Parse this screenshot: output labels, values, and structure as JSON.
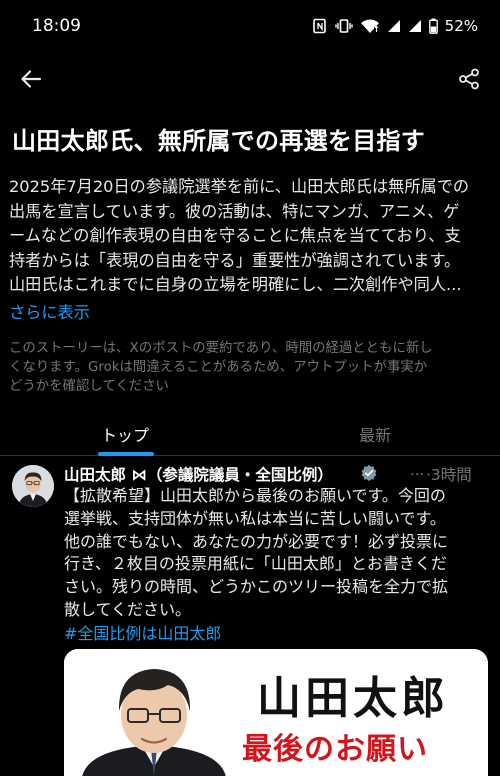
{
  "status_bar": {
    "time": "18:09",
    "battery": "52%"
  },
  "app_bar": {
    "back_icon": "arrow-left-icon",
    "share_icon": "share-icon"
  },
  "story": {
    "title": "山田太郎氏、無所属での再選を目指す",
    "summary_lines": [
      "2025年7月20日の参議院選挙を前に、山田太郎氏は無所属での",
      "出馬を宣言しています。彼の活動は、特にマンガ、アニメ、ゲ",
      "ームなどの創作表現の自由を守ることに焦点を当てており、支",
      "持者からは「表現の自由を守る」重要性が強調されています。",
      "山田氏はこれまでに自身の立場を明確にし、二次創作や同人..."
    ],
    "show_more": "さらに表示",
    "disclaimer_lines": [
      "このストーリーは、Xのポストの要約であり、時間の経過とともに新し",
      "くなります。Grokは間違えることがあるため、アウトプットが事実か",
      "どうかを確認してください"
    ]
  },
  "tabs": [
    {
      "label": "トップ",
      "active": true
    },
    {
      "label": "最新",
      "active": false
    }
  ],
  "post": {
    "author": "山田太郎 ⋈（参議院議員・全国比例）",
    "verified": true,
    "dots": "...",
    "time": "·3時間",
    "text_lines": [
      "【拡散希望】山田太郎から最後のお願いです。今回の",
      "選挙戦、支持団体が無い私は本当に苦しい闘いです。",
      "他の誰でもない、あなたの力が必要です！必ず投票に",
      "行き、２枚目の投票用紙に「山田太郎」とお書きくだ",
      "さい。残りの時間、どうかこのツリー投稿を全力で拡",
      "散してください。"
    ],
    "hashtag": "#全国比例は山田太郎",
    "media": {
      "name": "山田太郎",
      "subtitle": "最後のお願い"
    }
  },
  "colors": {
    "background": "#000000",
    "accent": "#1d9bf0",
    "muted_text": "#71767b",
    "primary_text": "#e7e9ea",
    "media_red": "#d4141c"
  }
}
